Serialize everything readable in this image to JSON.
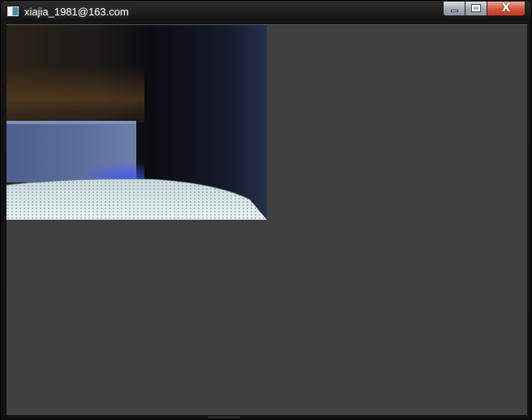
{
  "window": {
    "title": "xiajia_1981@163.com",
    "icon": "opencv-window-icon",
    "controls": {
      "minimize_icon": "minimize-icon",
      "maximize_icon": "maximize-icon",
      "close_icon": "close-icon",
      "close_glyph": "X"
    }
  },
  "client": {
    "background": "#404040"
  },
  "video_frame": {
    "content": "camera-frame"
  }
}
